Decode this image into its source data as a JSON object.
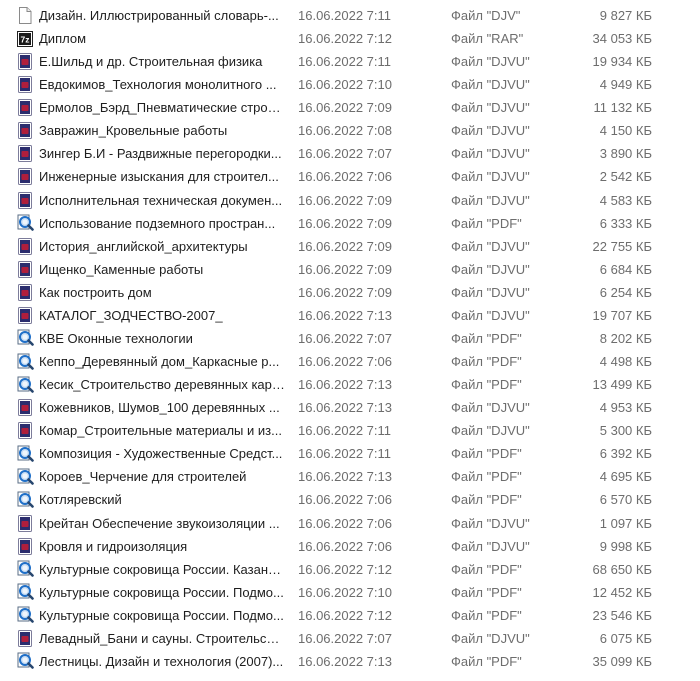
{
  "files": [
    {
      "name": "Дизайн. Иллюстрированный словарь-...",
      "date": "16.06.2022 7:11",
      "type": "Файл \"DJV\"",
      "size": "9 827 КБ",
      "icon": "generic-file-icon"
    },
    {
      "name": "Диплом",
      "date": "16.06.2022 7:12",
      "type": "Файл \"RAR\"",
      "size": "34 053 КБ",
      "icon": "7zip-archive-icon"
    },
    {
      "name": "Е.Шильд и др. Строительная физика",
      "date": "16.06.2022 7:11",
      "type": "Файл \"DJVU\"",
      "size": "19 934 КБ",
      "icon": "djvu-document-icon"
    },
    {
      "name": "Евдокимов_Технология монолитного ...",
      "date": "16.06.2022 7:10",
      "type": "Файл \"DJVU\"",
      "size": "4 949 КБ",
      "icon": "djvu-document-icon"
    },
    {
      "name": "Ермолов_Бэрд_Пневматические строи...",
      "date": "16.06.2022 7:09",
      "type": "Файл \"DJVU\"",
      "size": "11 132 КБ",
      "icon": "djvu-document-icon"
    },
    {
      "name": "Завражин_Кровельные работы",
      "date": "16.06.2022 7:08",
      "type": "Файл \"DJVU\"",
      "size": "4 150 КБ",
      "icon": "djvu-document-icon"
    },
    {
      "name": "Зингер Б.И - Раздвижные перегородки...",
      "date": "16.06.2022 7:07",
      "type": "Файл \"DJVU\"",
      "size": "3 890 КБ",
      "icon": "djvu-document-icon"
    },
    {
      "name": "Инженерные изыскания для строител...",
      "date": "16.06.2022 7:06",
      "type": "Файл \"DJVU\"",
      "size": "2 542 КБ",
      "icon": "djvu-document-icon"
    },
    {
      "name": "Исполнительная техническая докумен...",
      "date": "16.06.2022 7:09",
      "type": "Файл \"DJVU\"",
      "size": "4 583 КБ",
      "icon": "djvu-document-icon"
    },
    {
      "name": "Использование подземного простран...",
      "date": "16.06.2022 7:09",
      "type": "Файл \"PDF\"",
      "size": "6 333 КБ",
      "icon": "pdf-viewer-icon"
    },
    {
      "name": "История_английской_архитектуры",
      "date": "16.06.2022 7:09",
      "type": "Файл \"DJVU\"",
      "size": "22 755 КБ",
      "icon": "djvu-document-icon"
    },
    {
      "name": "Ищенко_Каменные работы",
      "date": "16.06.2022 7:09",
      "type": "Файл \"DJVU\"",
      "size": "6 684 КБ",
      "icon": "djvu-document-icon"
    },
    {
      "name": "Как построить дом",
      "date": "16.06.2022 7:09",
      "type": "Файл \"DJVU\"",
      "size": "6 254 КБ",
      "icon": "djvu-document-icon"
    },
    {
      "name": "КАТАЛОГ_ЗОДЧЕСТВО-2007_",
      "date": "16.06.2022 7:13",
      "type": "Файл \"DJVU\"",
      "size": "19 707 КБ",
      "icon": "djvu-document-icon"
    },
    {
      "name": "КВЕ Оконные технологии",
      "date": "16.06.2022 7:07",
      "type": "Файл \"PDF\"",
      "size": "8 202 КБ",
      "icon": "pdf-viewer-icon"
    },
    {
      "name": "Кеппо_Деревянный дом_Каркасные р...",
      "date": "16.06.2022 7:06",
      "type": "Файл \"PDF\"",
      "size": "4 498 КБ",
      "icon": "pdf-viewer-icon"
    },
    {
      "name": "Кесик_Строительство деревянных карк...",
      "date": "16.06.2022 7:13",
      "type": "Файл \"PDF\"",
      "size": "13 499 КБ",
      "icon": "pdf-viewer-icon"
    },
    {
      "name": "Кожевников, Шумов_100 деревянных ...",
      "date": "16.06.2022 7:13",
      "type": "Файл \"DJVU\"",
      "size": "4 953 КБ",
      "icon": "djvu-document-icon"
    },
    {
      "name": "Комар_Строительные материалы и из...",
      "date": "16.06.2022 7:11",
      "type": "Файл \"DJVU\"",
      "size": "5 300 КБ",
      "icon": "djvu-document-icon"
    },
    {
      "name": "Композиция - Художественные Средст...",
      "date": "16.06.2022 7:11",
      "type": "Файл \"PDF\"",
      "size": "6 392 КБ",
      "icon": "pdf-viewer-icon"
    },
    {
      "name": "Короев_Черчение для строителей",
      "date": "16.06.2022 7:13",
      "type": "Файл \"PDF\"",
      "size": "4 695 КБ",
      "icon": "pdf-viewer-icon"
    },
    {
      "name": "Котляревский",
      "date": "16.06.2022 7:06",
      "type": "Файл \"PDF\"",
      "size": "6 570 КБ",
      "icon": "pdf-viewer-icon"
    },
    {
      "name": "Крейтан Обеспечение звукоизоляции ...",
      "date": "16.06.2022 7:06",
      "type": "Файл \"DJVU\"",
      "size": "1 097 КБ",
      "icon": "djvu-document-icon"
    },
    {
      "name": "Кровля и гидроизоляция",
      "date": "16.06.2022 7:06",
      "type": "Файл \"DJVU\"",
      "size": "9 998 КБ",
      "icon": "djvu-document-icon"
    },
    {
      "name": "Культурные сокровища России. Казань...",
      "date": "16.06.2022 7:12",
      "type": "Файл \"PDF\"",
      "size": "68 650 КБ",
      "icon": "pdf-viewer-icon"
    },
    {
      "name": "Культурные сокровища России. Подмо...",
      "date": "16.06.2022 7:10",
      "type": "Файл \"PDF\"",
      "size": "12 452 КБ",
      "icon": "pdf-viewer-icon"
    },
    {
      "name": "Культурные сокровища России. Подмо...",
      "date": "16.06.2022 7:12",
      "type": "Файл \"PDF\"",
      "size": "23 546 КБ",
      "icon": "pdf-viewer-icon"
    },
    {
      "name": "Левадный_Бани и сауны. Строительств...",
      "date": "16.06.2022 7:07",
      "type": "Файл \"DJVU\"",
      "size": "6 075 КБ",
      "icon": "djvu-document-icon"
    },
    {
      "name": "Лестницы. Дизайн и технология (2007)...",
      "date": "16.06.2022 7:13",
      "type": "Файл \"PDF\"",
      "size": "35 099 КБ",
      "icon": "pdf-viewer-icon"
    }
  ],
  "colors": {
    "name_text": "#1e1e1e",
    "meta_text": "#6d6d6d",
    "djvu_icon": "#b01e3c",
    "pdf_icon": "#1f6fc8"
  },
  "icon_labels": {
    "archive": "7z"
  }
}
